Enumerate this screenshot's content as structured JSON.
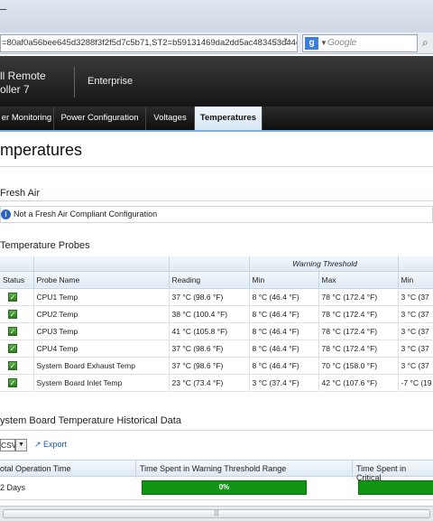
{
  "browser": {
    "title_fragment": "–",
    "url": "=80af0a56bee645d3288f3f2f5d7c5b71,ST2=b59131469da2dd5ac483453d44ec01",
    "search_engine_letter": "g",
    "search_placeholder": "Google"
  },
  "banner": {
    "product_line1": "ll Remote",
    "product_line2": "oller 7",
    "edition": "Enterprise"
  },
  "tabs": [
    {
      "label": "er Monitoring",
      "active": false
    },
    {
      "label": "Power Configuration",
      "active": false
    },
    {
      "label": "Voltages",
      "active": false
    },
    {
      "label": "Temperatures",
      "active": true
    }
  ],
  "page": {
    "title": "mperatures"
  },
  "fresh_air": {
    "section_title": "Fresh Air",
    "message": "Not a Fresh Air Compliant Configuration"
  },
  "probes": {
    "section_title": "Temperature Probes",
    "band_label": "Warning Threshold",
    "columns": [
      "Status",
      "Probe Name",
      "Reading",
      "Min",
      "Max",
      "Min"
    ],
    "rows": [
      {
        "name": "CPU1 Temp",
        "reading": "37 °C (98.6 °F)",
        "warn_min": "8 °C (46.4 °F)",
        "warn_max": "78 °C (172.4 °F)",
        "fail_min": "3 °C (37"
      },
      {
        "name": "CPU2 Temp",
        "reading": "38 °C (100.4 °F)",
        "warn_min": "8 °C (46.4 °F)",
        "warn_max": "78 °C (172.4 °F)",
        "fail_min": "3 °C (37"
      },
      {
        "name": "CPU3 Temp",
        "reading": "41 °C (105.8 °F)",
        "warn_min": "8 °C (46.4 °F)",
        "warn_max": "78 °C (172.4 °F)",
        "fail_min": "3 °C (37"
      },
      {
        "name": "CPU4 Temp",
        "reading": "37 °C (98.6 °F)",
        "warn_min": "8 °C (46.4 °F)",
        "warn_max": "78 °C (172.4 °F)",
        "fail_min": "3 °C (37"
      },
      {
        "name": "System Board Exhaust Temp",
        "reading": "37 °C (98.6 °F)",
        "warn_min": "8 °C (46.4 °F)",
        "warn_max": "70 °C (158.0 °F)",
        "fail_min": "3 °C (37"
      },
      {
        "name": "System Board Inlet Temp",
        "reading": "23 °C (73.4 °F)",
        "warn_min": "3 °C (37.4 °F)",
        "warn_max": "42 °C (107.6 °F)",
        "fail_min": "-7 °C (19"
      }
    ]
  },
  "history": {
    "section_title": "ystem Board Temperature Historical Data",
    "format_value": "CSV",
    "export_label": "Export",
    "columns": [
      "otal Operation Time",
      "Time Spent in Warning Threshold Range",
      "Time Spent in Critical"
    ],
    "operation_time": "2 Days",
    "warning_percent_label": "0%",
    "warning_fraction": 0.0
  },
  "colors": {
    "status_ok": "#2d7d1f",
    "progress": "#129414",
    "tab_accent": "#7db0d8"
  }
}
